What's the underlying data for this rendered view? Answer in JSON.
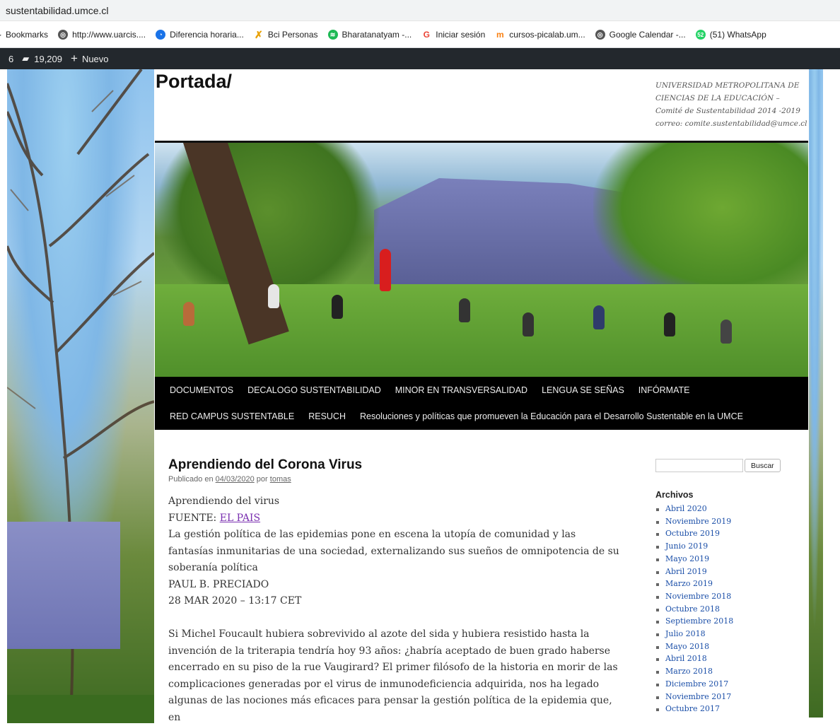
{
  "browser": {
    "url": "sustentabilidad.umce.cl",
    "bookmarks": [
      {
        "label": "Bookmarks",
        "icon": "bookmarks-icon"
      },
      {
        "label": "http://www.uarcis....",
        "icon": "globe-icon"
      },
      {
        "label": "Diferencia horaria...",
        "icon": "clock-icon"
      },
      {
        "label": "Bci Personas",
        "icon": "bci-icon"
      },
      {
        "label": "Bharatanatyam -...",
        "icon": "spotify-icon"
      },
      {
        "label": "Iniciar sesión",
        "icon": "google-icon"
      },
      {
        "label": "cursos-picalab.um...",
        "icon": "moodle-icon"
      },
      {
        "label": "Google Calendar -...",
        "icon": "globe-icon"
      },
      {
        "label": "(51) WhatsApp",
        "icon": "whatsapp-icon",
        "badge": "52"
      }
    ]
  },
  "adminbar": {
    "count_prefix": "6",
    "comments_count": "19,209",
    "new_label": "Nuevo"
  },
  "site": {
    "title": "Portada/",
    "description_lines": [
      "UNIVERSIDAD METROPOLITANA DE",
      "CIENCIAS DE LA EDUCACIÓN –",
      "Comité de Sustentabilidad 2014 -2019",
      "correo: comite.sustentabilidad@umce.cl"
    ]
  },
  "nav": {
    "row1": [
      "DOCUMENTOS",
      "DECALOGO SUSTENTABILIDAD",
      "MINOR EN TRANSVERSALIDAD",
      "LENGUA SE SEÑAS",
      "INFÓRMATE"
    ],
    "row2": [
      "RED CAMPUS SUSTENTABLE",
      "RESUCH",
      "Resoluciones y políticas que promueven la Educación para el Desarrollo Sustentable en la UMCE"
    ]
  },
  "post": {
    "title": "Aprendiendo del Corona Virus",
    "meta_prefix": "Publicado en",
    "date": "04/03/2020",
    "by": "por",
    "author": "tomas",
    "line1": "Aprendiendo del virus",
    "source_label": "FUENTE:",
    "source_link": "EL PAIS",
    "lead": "La gestión política de las epidemias pone en escena la utopía de comunidad y las fantasías inmunitarias de una sociedad, externalizando sus sueños de omnipotencia de su soberanía política",
    "byline": "PAUL B. PRECIADO",
    "dateline": "28 MAR 2020 – 13:17 CET",
    "body": "Si Michel Foucault hubiera sobrevivido al azote del sida y hubiera resistido hasta la invención de la triterapia tendría hoy 93 años: ¿habría aceptado de buen grado haberse encerrado en su piso de la rue Vaugirard? El primer filósofo de la historia en morir de las complicaciones generadas por el virus de inmunodeficiencia adquirida, nos ha legado algunas de las nociones más eficaces para pensar la gestión política de la epidemia que, en"
  },
  "sidebar": {
    "search_button": "Buscar",
    "search_value": "",
    "archives_title": "Archivos",
    "archives": [
      "Abril 2020",
      "Noviembre 2019",
      "Octubre 2019",
      "Junio 2019",
      "Mayo 2019",
      "Abril 2019",
      "Marzo 2019",
      "Noviembre 2018",
      "Octubre 2018",
      "Septiembre 2018",
      "Julio 2018",
      "Mayo 2018",
      "Abril 2018",
      "Marzo 2018",
      "Diciembre 2017",
      "Noviembre 2017",
      "Octubre 2017"
    ]
  },
  "colors": {
    "adminbar_bg": "#23282d",
    "nav_bg": "#000000",
    "link_visited": "#7a2fb0",
    "archive_link": "#1b4fa8"
  }
}
